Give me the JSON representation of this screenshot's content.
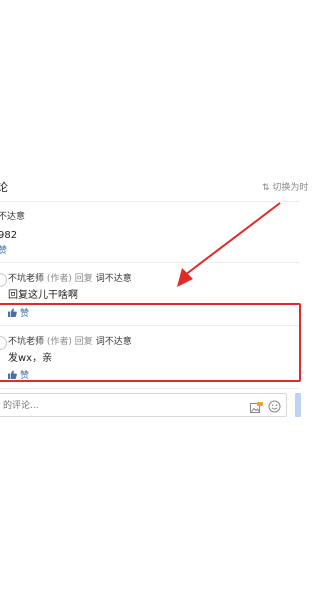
{
  "header": {
    "title_fragment": "论",
    "switch_label": "切换为时"
  },
  "top_comment": {
    "author_fragment": "不达意",
    "text_fragment": "982",
    "like_label": "赞"
  },
  "replies": [
    {
      "author": "不坑老师",
      "author_tag": "(作者)",
      "action": "回复",
      "target": "词不达意",
      "text": "回复这儿干啥啊",
      "like_label": "赞"
    },
    {
      "author": "不坑老师",
      "author_tag": "(作者)",
      "action": "回复",
      "target": "词不达意",
      "text": "发wx，亲",
      "like_label": "赞"
    }
  ],
  "input": {
    "placeholder": "的评论..."
  },
  "colors": {
    "annotation_red": "#e12a2a",
    "link_blue": "#3b6fb6",
    "send_button_blue": "#bcd3f2"
  }
}
